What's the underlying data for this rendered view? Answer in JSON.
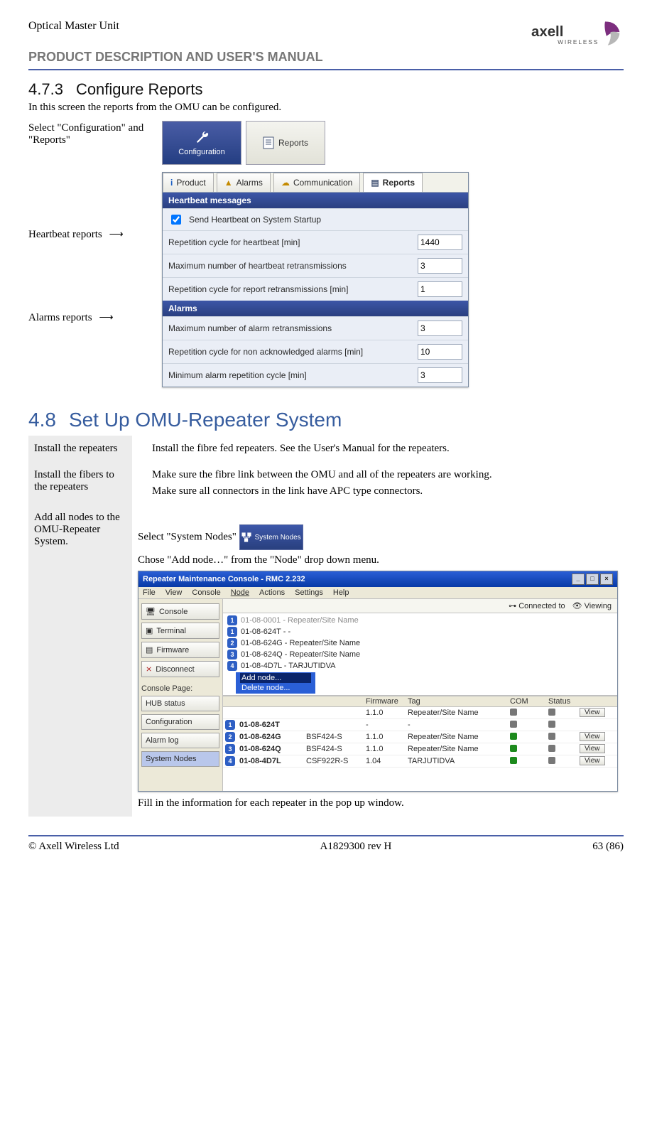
{
  "header": {
    "line1": "Optical Master Unit",
    "line2": "PRODUCT DESCRIPTION AND USER'S MANUAL",
    "brand_word": "axell",
    "brand_sub": "WIRELESS"
  },
  "sec473": {
    "num": "4.7.3",
    "title": "Configure Reports",
    "intro": "In this screen the reports from the OMU can be configured.",
    "left_select": "Select \"Configuration\" and \"Reports\"",
    "left_heartbeat": "Heartbeat reports",
    "left_alarms": "Alarms reports",
    "cfg_btn": "Configuration",
    "reports_btn": "Reports",
    "tabs": {
      "product": "Product",
      "alarms": "Alarms",
      "communication": "Communication",
      "reports": "Reports"
    },
    "hb_head": "Heartbeat messages",
    "hb_send": "Send Heartbeat on System Startup",
    "hb_rep_cycle": "Repetition cycle for heartbeat [min]",
    "hb_max_retrans": "Maximum number of heartbeat retransmissions",
    "hb_rep_retrans": "Repetition cycle for report retransmissions [min]",
    "al_head": "Alarms",
    "al_max_retrans": "Maximum number of alarm retransmissions",
    "al_rep_non_ack": "Repetition cycle for non acknowledged alarms [min]",
    "al_min_rep": "Minimum alarm repetition cycle [min]",
    "values": {
      "hb_rep_cycle": "1440",
      "hb_max_retrans": "3",
      "hb_rep_retrans": "1",
      "al_max_retrans": "3",
      "al_rep_non_ack": "10",
      "al_min_rep": "3"
    }
  },
  "sec48": {
    "num": "4.8",
    "title": "Set Up OMU-Repeater System",
    "step1_label": "Install the repeaters",
    "step1_body": "Install the fibre fed repeaters. See the User's Manual for the repeaters.",
    "step2_label": "Install the fibers to the repeaters",
    "step2_body_a": "Make sure the fibre link between the OMU and all of the repeaters are working.",
    "step2_body_b": "Make sure all connectors in the link have APC type connectors.",
    "step3_label": "Add all nodes to the OMU-Repeater System.",
    "step3_body_a_pre": "Select \"System Nodes\" ",
    "sys_nodes_btn": "System Nodes",
    "step3_body_b": "Chose \"Add node…\" from the \"Node\" drop down menu.",
    "step3_footer": "Fill in the information for each repeater in the pop up window.",
    "rmc": {
      "title": "Repeater Maintenance Console - RMC 2.232",
      "menu": {
        "file": "File",
        "view": "View",
        "console": "Console",
        "node": "Node",
        "actions": "Actions",
        "settings": "Settings",
        "help": "Help"
      },
      "side": {
        "console": "Console",
        "terminal": "Terminal",
        "firmware": "Firmware",
        "disconnect": "Disconnect",
        "cp_label": "Console Page:",
        "hub": "HUB status",
        "config": "Configuration",
        "alarm": "Alarm log",
        "nodes": "System Nodes"
      },
      "status": {
        "connected": "Connected to",
        "viewing": "Viewing"
      },
      "dropdown": {
        "add": "Add node...",
        "delete": "Delete node..."
      },
      "nodes": [
        {
          "n": "1",
          "id": "01-08-0001",
          "suffix": "- Repeater/Site Name",
          "grey": true
        },
        {
          "n": "1",
          "id": "01-08-624T",
          "suffix": "- -",
          "grey": false
        },
        {
          "n": "2",
          "id": "01-08-624G",
          "suffix": "- Repeater/Site Name",
          "grey": false
        },
        {
          "n": "3",
          "id": "01-08-624Q",
          "suffix": "- Repeater/Site Name",
          "grey": false
        },
        {
          "n": "4",
          "id": "01-08-4D7L",
          "suffix": "- TARJUTIDVA",
          "grey": false
        }
      ],
      "thead": {
        "id": "",
        "fw": "Firmware",
        "tag": "Tag",
        "com": "COM",
        "status": "Status",
        "view": ""
      },
      "rows": [
        {
          "n": "",
          "id": "",
          "model": "",
          "fw": "1.1.0",
          "tag": "Repeater/Site Name",
          "com": "grey",
          "status": "grey",
          "view": "View"
        },
        {
          "n": "1",
          "id": "01-08-624T",
          "model": "",
          "fw": "-",
          "tag": "-",
          "com": "grey",
          "status": "grey",
          "view": ""
        },
        {
          "n": "2",
          "id": "01-08-624G",
          "model": "BSF424-S",
          "fw": "1.1.0",
          "tag": "Repeater/Site Name",
          "com": "green",
          "status": "grey",
          "view": "View"
        },
        {
          "n": "3",
          "id": "01-08-624Q",
          "model": "BSF424-S",
          "fw": "1.1.0",
          "tag": "Repeater/Site Name",
          "com": "green",
          "status": "grey",
          "view": "View"
        },
        {
          "n": "4",
          "id": "01-08-4D7L",
          "model": "CSF922R-S",
          "fw": "1.04",
          "tag": "TARJUTIDVA",
          "com": "green",
          "status": "grey",
          "view": "View"
        }
      ]
    }
  },
  "footer": {
    "left": "© Axell Wireless Ltd",
    "center": "A1829300 rev H",
    "right": "63 (86)"
  }
}
